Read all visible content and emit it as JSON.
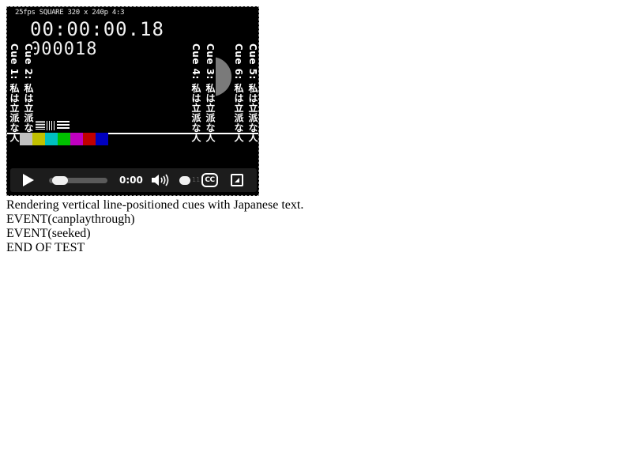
{
  "video": {
    "overlay_label": "25fps SQUARE 320 x 240p 4:3",
    "timecode": "00:00:00.18",
    "frame_count": "000018",
    "cues": [
      {
        "id": "cue1",
        "text": "Cue 1: 私は立派な人"
      },
      {
        "id": "cue2",
        "text": "Cue 2: 私は立派な人"
      },
      {
        "id": "cue4",
        "text": "Cue 4: 私は立派な人"
      },
      {
        "id": "cue3",
        "text": "Cue 3: 私は立派な人"
      },
      {
        "id": "cue6",
        "text": "Cue 6: 私は立派な人"
      },
      {
        "id": "cue5",
        "text": "Cue 5: 私は立派な人"
      }
    ],
    "color_bars": [
      "#c0c0c0",
      "#c0c000",
      "#00c0c0",
      "#00c000",
      "#c000c0",
      "#c00000",
      "#0000c0"
    ]
  },
  "controls": {
    "current_time": "0:00",
    "cc_label": "CC",
    "volume_ghost": "11",
    "icons": {
      "play": "play-icon",
      "mute": "speaker-icon",
      "fullscreen": "fullscreen-icon"
    }
  },
  "log": {
    "lines": [
      "Rendering vertical line-positioned cues with Japanese text.",
      "EVENT(canplaythrough)",
      "EVENT(seeked)",
      "END OF TEST"
    ]
  }
}
